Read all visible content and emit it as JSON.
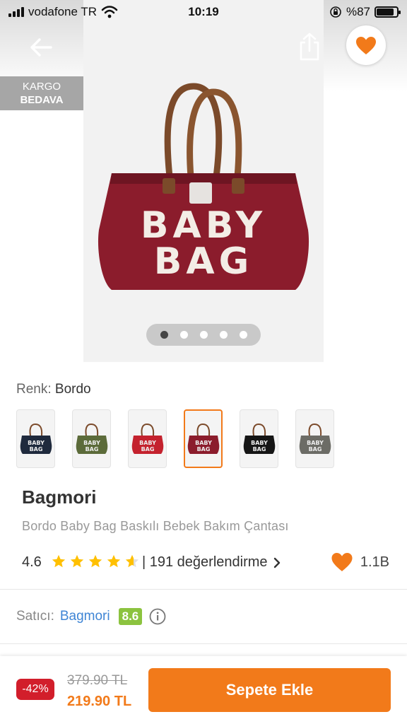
{
  "status_bar": {
    "carrier": "vodafone TR",
    "time": "10:19",
    "battery_text": "%87",
    "battery_level": 0.87
  },
  "top_bar": {
    "back_icon": "arrow-left-icon",
    "share_icon": "share-icon",
    "favorite_icon": "heart-icon"
  },
  "badge": {
    "line1": "KARGO",
    "line2": "BEDAVA"
  },
  "product_image": {
    "bag_text_line1": "BABY",
    "bag_text_line2": "BAG",
    "page_count": 5,
    "active_page": 1
  },
  "color_select": {
    "label": "Renk:",
    "value": "Bordo",
    "options": [
      {
        "name": "navy",
        "color": "#1f2a3d",
        "selected": false
      },
      {
        "name": "khaki",
        "color": "#5c6b3a",
        "selected": false
      },
      {
        "name": "red",
        "color": "#c4222e",
        "selected": false
      },
      {
        "name": "bordo",
        "color": "#8b1c2c",
        "selected": true
      },
      {
        "name": "black",
        "color": "#151515",
        "selected": false
      },
      {
        "name": "grey",
        "color": "#6c6c66",
        "selected": false
      }
    ],
    "swatch_text1": "BABY",
    "swatch_text2": "BAG"
  },
  "product": {
    "brand": "Bagmori",
    "name": "Bordo Baby Bag Baskılı Bebek Bakım Çantası",
    "rating": "4.6",
    "rating_value": 4.6,
    "reviews": "| 191 değerlendirme",
    "favorites": "1.1B"
  },
  "seller": {
    "label": "Satıcı:",
    "name": "Bagmori",
    "score": "8.6"
  },
  "purchase": {
    "discount": "-42%",
    "old_price": "379.90 TL",
    "new_price": "219.90 TL",
    "button": "Sepete Ekle"
  },
  "colors": {
    "accent": "#f27a1a",
    "discount": "#d21e2b",
    "seller_link": "#3f85d5",
    "score_green": "#8cc33f",
    "bag_bordo": "#8b1c2c"
  }
}
